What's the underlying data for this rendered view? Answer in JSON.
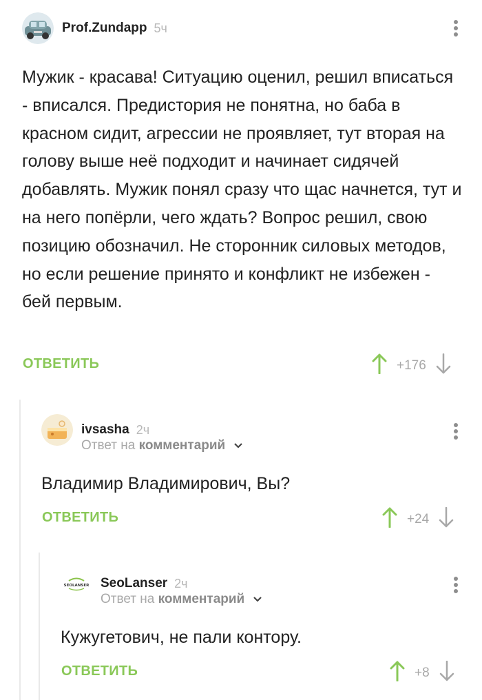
{
  "comments": [
    {
      "username": "Prof.Zundapp",
      "time": "5ч",
      "text": "Мужик - красава! Ситуацию оценил, решил вписаться - вписался. Предистория не понятна, но баба в красном сидит, агрессии не проявляет, тут вторая на голову выше неё подходит и начинает сидячей добавлять. Мужик понял сразу что щас начнется, тут и на него попёрли, чего ждать? Вопрос решил, свою позицию обозначил. Не сторонник силовых методов, но если решение принято и конфликт не избежен - бей первым.",
      "reply_label": "ОТВЕТИТЬ",
      "score": "+176"
    },
    {
      "username": "ivsasha",
      "time": "2ч",
      "reply_prefix": "Ответ на",
      "reply_target": "комментарий",
      "text": "Владимир Владимирович, Вы?",
      "reply_label": "ОТВЕТИТЬ",
      "score": "+24"
    },
    {
      "username": "SeoLanser",
      "time": "2ч",
      "reply_prefix": "Ответ на",
      "reply_target": "комментарий",
      "text": "Кужугетович, не пали контору.",
      "reply_label": "ОТВЕТИТЬ",
      "score": "+8"
    }
  ],
  "colors": {
    "accent": "#8ac858",
    "muted": "#a8a8a8",
    "text": "#222222",
    "thread_line": "#e9e9e9"
  },
  "icons": [
    "car-avatar",
    "cake-avatar",
    "seolanser-logo-avatar",
    "kebab-menu-icon",
    "upvote-arrow-icon",
    "downvote-arrow-icon",
    "chevron-down-icon"
  ]
}
